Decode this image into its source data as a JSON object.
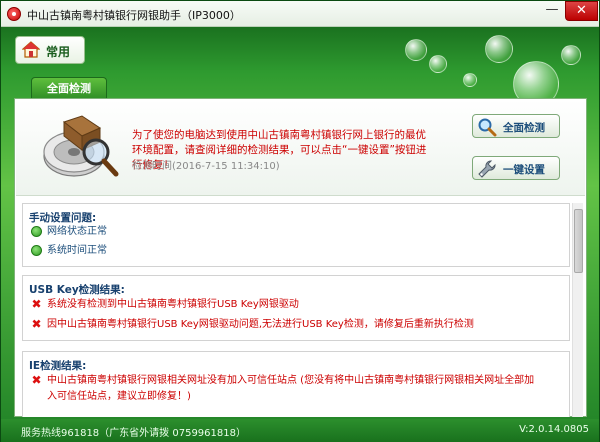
{
  "window": {
    "title": "中山古镇南粤村镇银行网银助手（IP3000）",
    "minimize_glyph": "—",
    "close_glyph": "✕"
  },
  "home_tab": {
    "label": "常用",
    "icon": "home-icon"
  },
  "active_tab": {
    "label": "全面检测"
  },
  "intro": {
    "message": "为了使您的电脑达到使用中山古镇南粤村镇银行网上银行的最优环境配置，请查阅详细的检测结果，可以点击“一键设置”按钮进行修复！",
    "time_label": "检测时间(2016-7-15 11:34:10)"
  },
  "actions": {
    "full_check": {
      "label": "全面检测",
      "icon": "magnifier-icon"
    },
    "one_click": {
      "label": "一键设置",
      "icon": "wrench-icon"
    }
  },
  "groups": [
    {
      "title": "手动设置问题:",
      "items": [
        {
          "status": "ok",
          "text": "网络状态正常"
        },
        {
          "status": "ok",
          "text": "系统时间正常"
        }
      ]
    },
    {
      "title": "USB Key检测结果:",
      "items": [
        {
          "status": "error",
          "text": "系统没有检测到中山古镇南粤村镇银行USB Key网银驱动"
        },
        {
          "status": "error",
          "text": "因中山古镇南粤村镇银行USB Key网银驱动问题,无法进行USB Key检测，请修复后重新执行检测"
        }
      ]
    },
    {
      "title": "IE检测结果:",
      "items": [
        {
          "status": "error",
          "text": "中山古镇南粤村镇银行网银相关网址没有加入可信任站点 (您没有将中山古镇南粤村镇银行网银相关网址全部加"
        },
        {
          "status": "error",
          "text": "入可信任站点，建议立即修复！)"
        }
      ]
    }
  ],
  "status_bar": {
    "hotline": "服务热线961818（广东省外请拨 0759961818）",
    "version": "V:2.0.14.0805"
  },
  "colors": {
    "brand_green": "#2f8e26",
    "error_red": "#cc0000",
    "label_blue": "#17406e"
  }
}
